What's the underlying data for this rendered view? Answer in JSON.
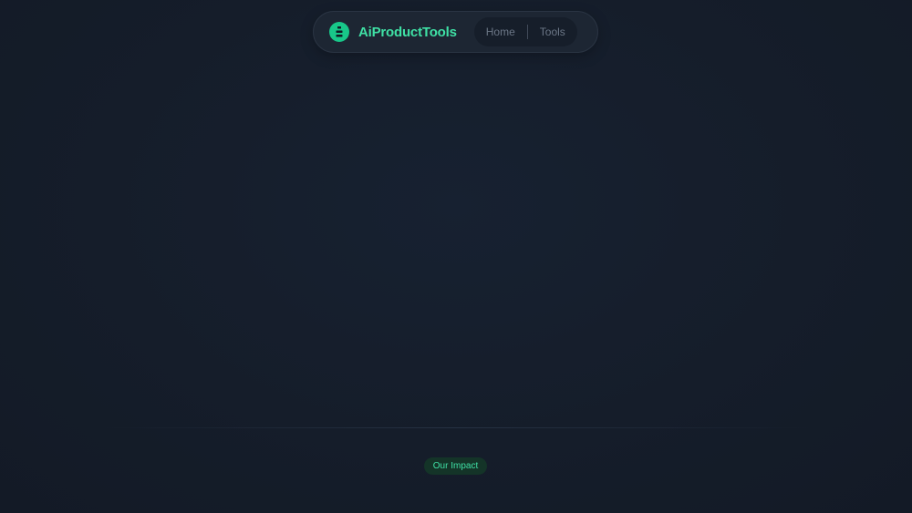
{
  "nav": {
    "brand": "AiProductTools",
    "links": [
      {
        "label": "Home"
      },
      {
        "label": "Tools"
      }
    ]
  },
  "impact": {
    "badge": "Our Impact"
  },
  "colors": {
    "background": "#161e2b",
    "accent": "#3fe0a5",
    "logo": "#18c789",
    "badge_bg": "#143428"
  },
  "icons": {
    "logo": "stacked-bars-logo-icon"
  }
}
